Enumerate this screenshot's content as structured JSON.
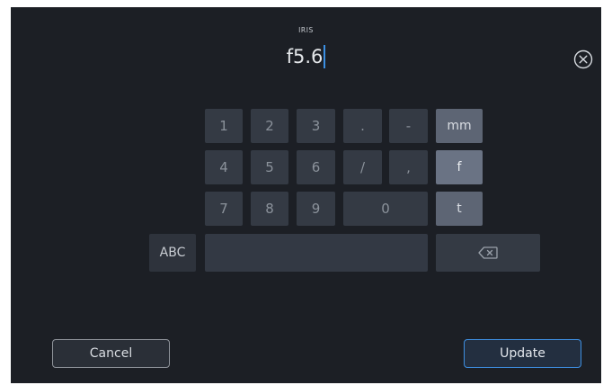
{
  "field": {
    "title": "IRIS",
    "value": "f5.6"
  },
  "keypad": {
    "keys": {
      "k1": "1",
      "k2": "2",
      "k3": "3",
      "dot": ".",
      "dash": "-",
      "k4": "4",
      "k5": "5",
      "k6": "6",
      "slash": "/",
      "comma": ",",
      "k7": "7",
      "k8": "8",
      "k9": "9",
      "k0": "0"
    },
    "units": {
      "mm": "mm",
      "f": "f",
      "t": "t"
    },
    "abc": "ABC",
    "backspace_icon": "backspace-icon"
  },
  "actions": {
    "cancel": "Cancel",
    "update": "Update"
  },
  "icons": {
    "close": "close-circle-icon"
  },
  "colors": {
    "background": "#1c1f25",
    "key": "#343a44",
    "unit_key": "#5d6574",
    "caret": "#3b8fe3",
    "update_border": "#3e8ee0"
  }
}
